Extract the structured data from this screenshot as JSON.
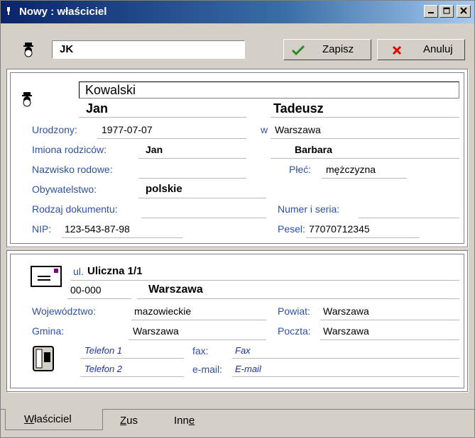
{
  "window": {
    "title": "Nowy : właściciel"
  },
  "toolbar": {
    "short_name": "JK",
    "save_label": "Zapisz",
    "cancel_label": "Anuluj"
  },
  "person": {
    "surname": "Kowalski",
    "first_name": "Jan",
    "second_name": "Tadeusz",
    "born_label": "Urodzony:",
    "born_value": "1977-07-07",
    "born_place_prefix": "w",
    "born_place": "Warszawa",
    "parents_label": "Imiona rodziców:",
    "father": "Jan",
    "mother": "Barbara",
    "maiden_label": "Nazwisko rodowe:",
    "maiden_value": "",
    "sex_label": "Płeć:",
    "sex_value": "mężczyzna",
    "citizenship_label": "Obywatelstwo:",
    "citizenship_value": "polskie",
    "doc_type_label": "Rodzaj dokumentu:",
    "doc_type_value": "",
    "doc_number_label": "Numer i seria:",
    "doc_number_value": "",
    "nip_label": "NIP:",
    "nip_value": "123-543-87-98",
    "pesel_label": "Pesel:",
    "pesel_value": "77070712345"
  },
  "address": {
    "street_prefix": "ul.",
    "street": "Uliczna 1/1",
    "postal_code": "00-000",
    "city": "Warszawa",
    "voivodeship_label": "Województwo:",
    "voivodeship_value": "mazowieckie",
    "county_label": "Powiat:",
    "county_value": "Warszawa",
    "commune_label": "Gmina:",
    "commune_value": "Warszawa",
    "post_label": "Poczta:",
    "post_value": "Warszawa",
    "phone1": "Telefon 1",
    "phone2": "Telefon 2",
    "fax_label": "fax:",
    "fax_value": "Fax",
    "email_label": "e-mail:",
    "email_value": "E-mail"
  },
  "tabs": [
    {
      "label": "Właściciel",
      "underline": "W",
      "rest": "łaściciel"
    },
    {
      "label": "Zus",
      "underline": "Z",
      "rest": "us"
    },
    {
      "label": "Inne",
      "pre": "Inn",
      "underline": "e"
    }
  ],
  "icons": {
    "window": "app-icon",
    "person": "person-icon",
    "save": "checkmark-icon",
    "cancel": "x-icon",
    "envelope": "envelope-icon",
    "phone": "phone-icon"
  },
  "colors": {
    "title_bar": "#0a246a",
    "label_text": "#3050a0",
    "italic_text": "#2030a0",
    "save_check": "#2a8a2a",
    "cancel_x": "#e00000"
  }
}
